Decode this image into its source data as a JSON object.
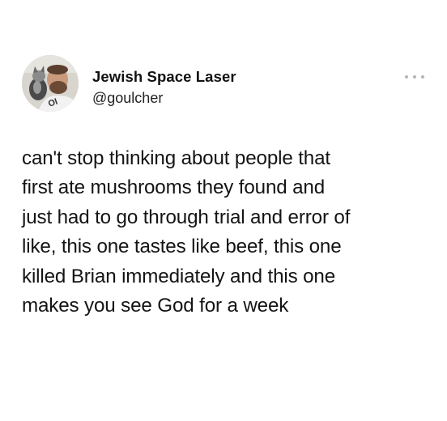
{
  "tweet": {
    "display_name": "Jewish Space Laser",
    "handle": "@goulcher",
    "avatar_icon": "profile-photo-avatar",
    "more_icon": "ellipsis-icon",
    "text_lines": [
      "can't stop thinking about people that",
      "first ate mushrooms they found and",
      "just had to go through trial and error of",
      "like, this one tastes like beef, this one",
      "killed Brian immediately and this one",
      "makes you see God for a week"
    ]
  },
  "colors": {
    "background": "#ffffff",
    "text": "#141414",
    "muted_dots": "#b5b5b5"
  }
}
